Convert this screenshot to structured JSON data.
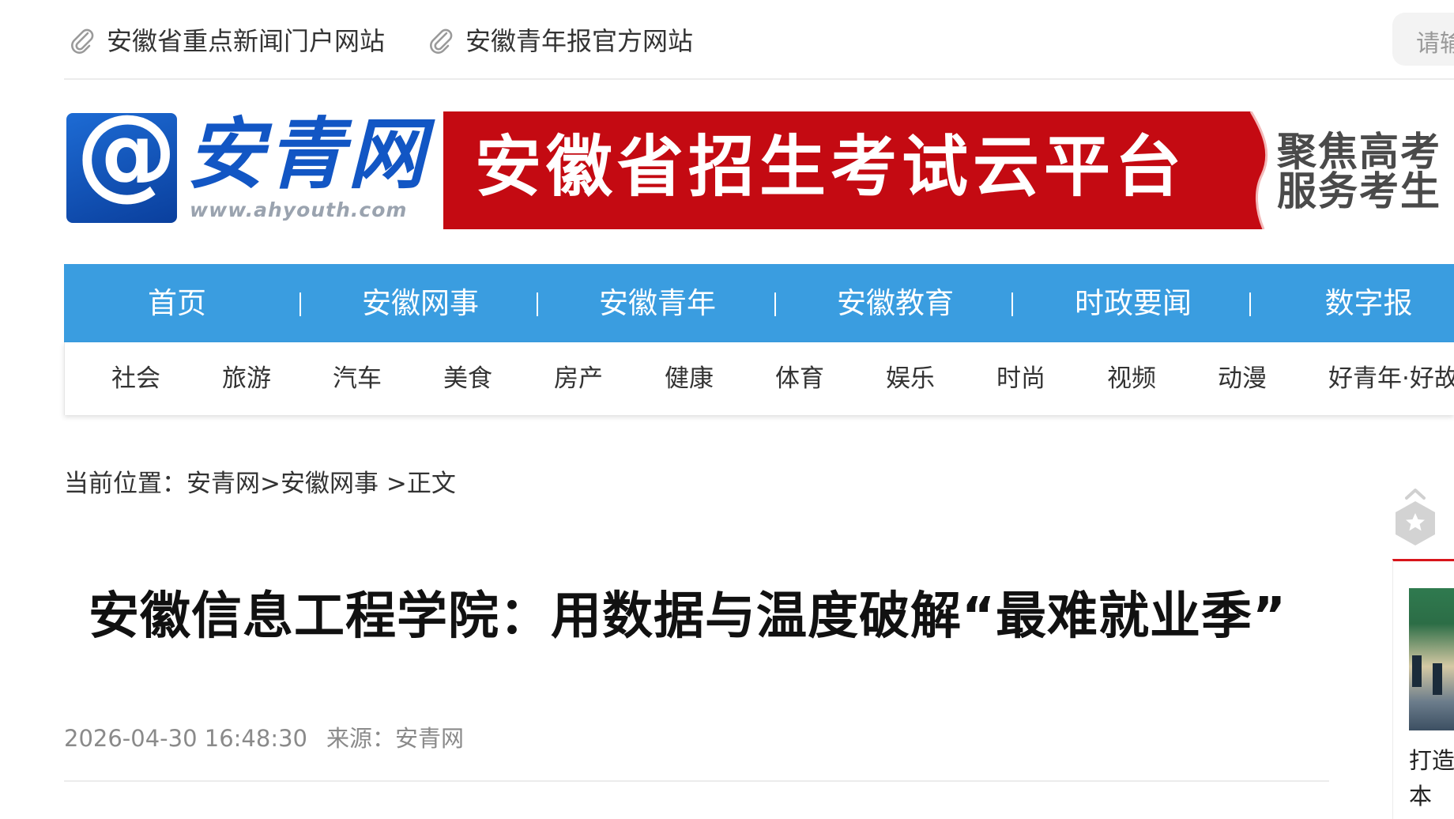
{
  "topbar": {
    "links": [
      {
        "label": "安徽省重点新闻门户网站"
      },
      {
        "label": "安徽青年报官方网站"
      }
    ],
    "search": {
      "placeholder": "请输"
    }
  },
  "logo": {
    "symbol": "@",
    "name": "安青网",
    "url": "www.ahyouth.com"
  },
  "banner": {
    "headline": "安徽省招生考试云平台",
    "side_line1": "聚焦高考",
    "side_line2": "服务考生",
    "accent": "#c40a12"
  },
  "nav_primary": {
    "bg_color": "#3a9de0",
    "items": [
      {
        "label": "首页"
      },
      {
        "label": "安徽网事"
      },
      {
        "label": "安徽青年"
      },
      {
        "label": "安徽教育"
      },
      {
        "label": "时政要闻"
      },
      {
        "label": "数字报"
      }
    ]
  },
  "nav_secondary": {
    "items": [
      {
        "label": "社会"
      },
      {
        "label": "旅游"
      },
      {
        "label": "汽车"
      },
      {
        "label": "美食"
      },
      {
        "label": "房产"
      },
      {
        "label": "健康"
      },
      {
        "label": "体育"
      },
      {
        "label": "娱乐"
      },
      {
        "label": "时尚"
      },
      {
        "label": "视频"
      },
      {
        "label": "动漫"
      },
      {
        "label": "好青年·好故"
      }
    ]
  },
  "breadcrumb": {
    "prefix": "当前位置：",
    "site": "安青网",
    "sep1": ">",
    "section": "安徽网事",
    "sep2": " >",
    "current": "正文"
  },
  "article": {
    "title": "安徽信息工程学院：用数据与温度破解“最难就业季”",
    "datetime": "2026-04-30 16:48:30",
    "source": "来源：安青网"
  },
  "sidebar": {
    "accent": "#d8151b",
    "line1": "打造",
    "line2": "本"
  }
}
